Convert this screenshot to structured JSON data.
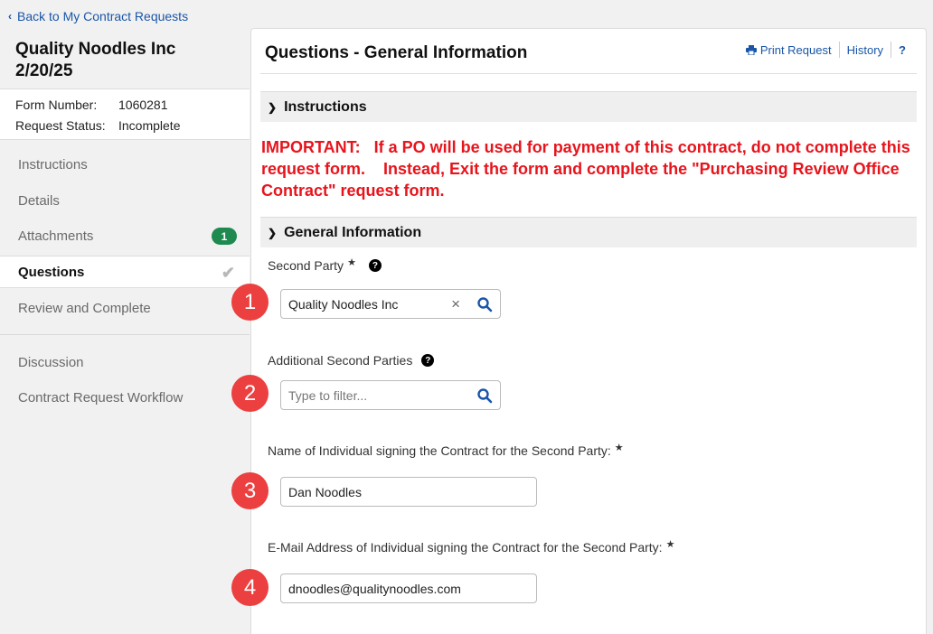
{
  "back_link": "Back to My Contract Requests",
  "request": {
    "title_line1": "Quality Noodles Inc",
    "title_line2": "2/20/25",
    "form_number_label": "Form Number:",
    "form_number": "1060281",
    "status_label": "Request Status:",
    "status": "Incomplete"
  },
  "nav": {
    "items": [
      {
        "label": "Instructions"
      },
      {
        "label": "Details"
      },
      {
        "label": "Attachments",
        "badge": "1"
      },
      {
        "label": "Questions"
      },
      {
        "label": "Review and Complete"
      },
      {
        "label": "Discussion"
      },
      {
        "label": "Contract Request Workflow"
      }
    ]
  },
  "main": {
    "title": "Questions - General Information",
    "toolbar": {
      "print": "Print Request",
      "history": "History",
      "help": "?"
    },
    "instructions_header": "Instructions",
    "important_text": "IMPORTANT:   If a PO will be used for payment of this contract, do not complete this request form.    Instead, Exit the form and complete the \"Purchasing Review Office Contract\" request form.",
    "general_header": "General Information",
    "fields": {
      "second_party_label": "Second Party",
      "second_party_value": "Quality Noodles Inc",
      "additional_label": "Additional Second Parties",
      "additional_placeholder": "Type to filter...",
      "signer_name_label": "Name of Individual signing the Contract for the Second Party:",
      "signer_name_value": "Dan Noodles",
      "signer_email_label": "E-Mail Address of Individual signing the Contract for the Second Party:",
      "signer_email_value": "dnoodles@qualitynoodles.com"
    },
    "steps": [
      "1",
      "2",
      "3",
      "4"
    ]
  },
  "colors": {
    "accent": "#1a56a8",
    "important": "#e8141c",
    "badge": "#1e8a4f",
    "step": "#ec3f3f"
  }
}
